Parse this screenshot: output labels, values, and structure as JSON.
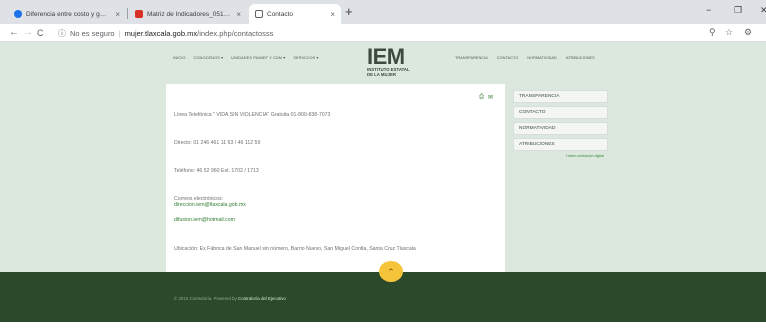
{
  "browser": {
    "tabs": [
      {
        "title": "Diferencia entre costo y gasto: cl",
        "favicon_color": "#1a73e8"
      },
      {
        "title": "Matriz de Indicadores_05162015",
        "favicon_color": "#d93025"
      },
      {
        "title": "Contacto",
        "favicon_color": "#ffffff"
      }
    ],
    "tab_close": "×",
    "new_tab": "+",
    "window_controls": {
      "minimize": "−",
      "maximize": "❐",
      "close": "✕"
    },
    "nav": {
      "back": "←",
      "forward": "→",
      "reload": "C"
    },
    "address": {
      "security_label": "No es seguro",
      "host": "mujer.tlaxcala.gob.mx",
      "path": "/index.php/contactosss"
    },
    "toolbar_icons": [
      "search-icon",
      "star-icon",
      "extension-icon"
    ]
  },
  "site": {
    "nav_left": [
      "INICIO",
      "CONOCENOS ▾",
      "UNIDADES PAIMEF Y CDM ▾",
      "SERVICIOS ▾"
    ],
    "logo": {
      "mark": "IEM",
      "line1": "INSTITUTO ESTATAL",
      "line2": "DE LA MUJER"
    },
    "nav_right": [
      "TRANSPARENCIA",
      "CONTACTO",
      "NORMATIVIDAD",
      "ATRIBUCIONES"
    ]
  },
  "content": {
    "line_violence": "Línea Telefónica \" VIDA SIN VIOLENCIA\" Gratuita 01-800-838-7073",
    "line_direct": "Directo: 01 246 461 11 63 / 46 112 59",
    "line_phone": "Teléfono: 46 52 960 Ext. 1702 / 1713",
    "emails_label": "Correos electrónicos:",
    "email_1": "direccion.iem@tlaxcala.gob.mx",
    "email_2": "difusion.iem@hotmail.com",
    "address": "Ubicación: Ex Fábrica de San Manuel sin número, Barrio Nuevo, San Miguel Contla, Santa Cruz Tlaxcala"
  },
  "sidebar": {
    "items": [
      "TRANSPARENCIA",
      "CONTACTO",
      "NORMATIVIDAD",
      "ATRIBUCIONES"
    ],
    "note": "Haber-mediación digital"
  },
  "footer": {
    "prefix": "© 2015 Contraloría. Powered by",
    "org": "Contraloría del Ejecutivo"
  },
  "scroll_top": "⌃"
}
